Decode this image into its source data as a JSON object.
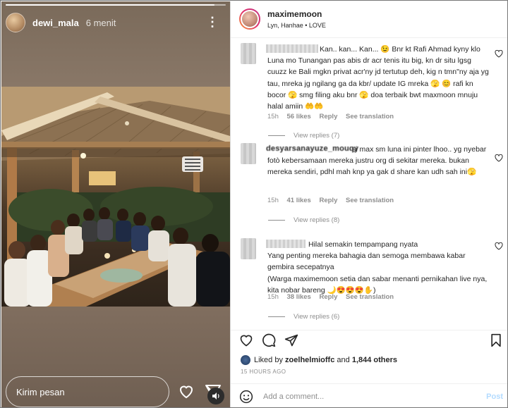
{
  "story": {
    "username": "dewi_mala",
    "time": "6 menit",
    "progress": 0.95,
    "message_placeholder": "Kirim pesan",
    "more_icon": "more-vertical-icon",
    "heart_icon": "heart-outline-icon",
    "send_icon": "send-icon",
    "sound_icon": "speaker-icon"
  },
  "post": {
    "username": "maximemoon",
    "subtitle": "Lyn, Hanhae • LOVE",
    "comments": [
      {
        "name": "",
        "text": "Kan.. kan... Kan... 😉 Bnr kt Rafi Ahmad kyny klo Luna mo Tunangan pas abis dr acr tenis itu big, kn dr situ lgsg cuuzz ke Bali mgkn privat acr'ny jd tertutup deh, kig n tmn\"ny aja yg tau, mreka jg ngilang ga da kbr/ update IG mreka 🫣 😊 rafi kn bocor 🫣 smg filing aku bnr 🫣 doa terbaik bwt maxmoon mnuju halal amiin 🤲🤲",
        "time": "15h",
        "likes": "56 likes",
        "reply": "Reply",
        "translate": "See translation",
        "view_replies": "View replies (7)"
      },
      {
        "name": "desyarsanayuze_mouqy",
        "text": "si max sm luna ini pinter lhoo.. yg nyebar fotò kebersamaan mereka justru org di sekitar mereka. bukan mereka sendiri, pdhl mah knp ya gak d share kan udh sah ini🫣",
        "time": "15h",
        "likes": "41 likes",
        "reply": "Reply",
        "translate": "See translation",
        "view_replies": "View replies (8)"
      },
      {
        "name": "",
        "text": "Hilal semakin tempampang nyata\nYang penting mereka bahagia dan semoga membawa kabar gembira secepatnya\n(Warga maximemoon setia dan sabar menanti pernikahan live nya, kita nobar bareng 🌙😍😍😍✋)",
        "time": "15h",
        "likes": "38 likes",
        "reply": "Reply",
        "translate": "See translation",
        "view_replies": "View replies (6)"
      }
    ],
    "actions": {
      "like_icon": "heart-outline-icon",
      "comment_icon": "comment-icon",
      "share_icon": "share-icon",
      "save_icon": "bookmark-icon"
    },
    "liked_by_prefix": "Liked by",
    "liked_by_user": "zoelhelmioffc",
    "liked_by_and": "and",
    "liked_by_others": "1,844 others",
    "date": "15 HOURS AGO",
    "add_comment_placeholder": "Add a comment...",
    "post_button": "Post"
  }
}
